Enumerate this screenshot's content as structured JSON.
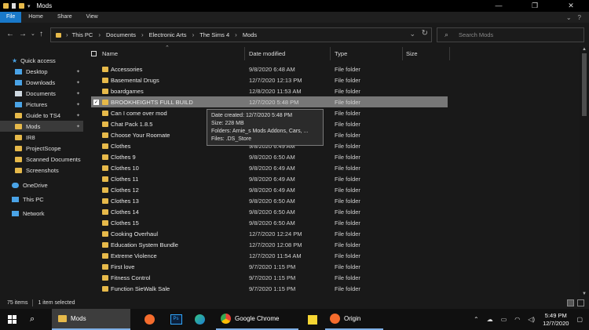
{
  "window": {
    "title": "Mods",
    "controls": [
      "—",
      "❐",
      "✕"
    ]
  },
  "ribbon": {
    "tabs": [
      "File",
      "Home",
      "Share",
      "View"
    ]
  },
  "address": {
    "crumbs": [
      "This PC",
      "Documents",
      "Electronic Arts",
      "The Sims 4",
      "Mods"
    ],
    "search_placeholder": "Search Mods"
  },
  "nav": {
    "items": [
      {
        "label": "Quick access",
        "icon": "star-icon",
        "color": "#4aa3e6",
        "pinned": false
      },
      {
        "label": "Desktop",
        "icon": "desktop-icon",
        "color": "#4aa3e6",
        "pinned": true
      },
      {
        "label": "Downloads",
        "icon": "download-icon",
        "color": "#4aa3e6",
        "pinned": true
      },
      {
        "label": "Documents",
        "icon": "documents-icon",
        "color": "#cfd8e0",
        "pinned": true
      },
      {
        "label": "Pictures",
        "icon": "pictures-icon",
        "color": "#4aa3e6",
        "pinned": true
      },
      {
        "label": "Guide to TS4",
        "icon": "folder-icon",
        "color": "#e6b94a",
        "pinned": true
      },
      {
        "label": "Mods",
        "icon": "folder-icon",
        "color": "#e6b94a",
        "pinned": true,
        "selected": true
      },
      {
        "label": "IR8",
        "icon": "folder-icon",
        "color": "#e6b94a",
        "pinned": false
      },
      {
        "label": "ProjectScope",
        "icon": "folder-icon",
        "color": "#e6b94a",
        "pinned": false
      },
      {
        "label": "Scanned Documents",
        "icon": "folder-icon",
        "color": "#e6b94a",
        "pinned": false
      },
      {
        "label": "Screenshots",
        "icon": "folder-icon",
        "color": "#e6b94a",
        "pinned": false
      },
      {
        "label": "OneDrive",
        "icon": "cloud-icon",
        "color": "#4aa3e6",
        "pinned": false
      },
      {
        "label": "This PC",
        "icon": "computer-icon",
        "color": "#4aa3e6",
        "pinned": false
      },
      {
        "label": "Network",
        "icon": "network-icon",
        "color": "#4aa3e6",
        "pinned": false
      }
    ]
  },
  "columns": {
    "name": "Name",
    "date": "Date modified",
    "type": "Type",
    "size": "Size"
  },
  "files": [
    {
      "name": "Accessories",
      "date": "9/8/2020 6:48 AM",
      "type": "File folder"
    },
    {
      "name": "Basemental Drugs",
      "date": "12/7/2020 12:13 PM",
      "type": "File folder"
    },
    {
      "name": "boardgames",
      "date": "12/8/2020 11:53 AM",
      "type": "File folder"
    },
    {
      "name": "BROOKHEIGHTS FULL BUILD",
      "date": "12/7/2020 5:48 PM",
      "type": "File folder",
      "selected": true
    },
    {
      "name": "Can I come over mod",
      "date": "",
      "type": "File folder"
    },
    {
      "name": "Chat Pack 1.8.5",
      "date": "",
      "type": "File folder"
    },
    {
      "name": "Choose Your Roomate",
      "date": "",
      "type": "File folder"
    },
    {
      "name": "Clothes",
      "date": "9/8/2020 6:49 AM",
      "type": "File folder"
    },
    {
      "name": "Clothes 9",
      "date": "9/8/2020 6:50 AM",
      "type": "File folder"
    },
    {
      "name": "Clothes 10",
      "date": "9/8/2020 6:49 AM",
      "type": "File folder"
    },
    {
      "name": "Clothes 11",
      "date": "9/8/2020 6:49 AM",
      "type": "File folder"
    },
    {
      "name": "Clothes 12",
      "date": "9/8/2020 6:49 AM",
      "type": "File folder"
    },
    {
      "name": "Clothes 13",
      "date": "9/8/2020 6:50 AM",
      "type": "File folder"
    },
    {
      "name": "Clothes 14",
      "date": "9/8/2020 6:50 AM",
      "type": "File folder"
    },
    {
      "name": "Clothes 15",
      "date": "9/8/2020 6:50 AM",
      "type": "File folder"
    },
    {
      "name": "Cooking Overhaul",
      "date": "12/7/2020 12:24 PM",
      "type": "File folder"
    },
    {
      "name": "Education System Bundle",
      "date": "12/7/2020 12:08 PM",
      "type": "File folder"
    },
    {
      "name": "Extreme Violence",
      "date": "12/7/2020 11:54 AM",
      "type": "File folder"
    },
    {
      "name": "First love",
      "date": "9/7/2020 1:15 PM",
      "type": "File folder"
    },
    {
      "name": "Fitness Control",
      "date": "9/7/2020 1:15 PM",
      "type": "File folder"
    },
    {
      "name": "Function SieWalk Sale",
      "date": "9/7/2020 1:15 PM",
      "type": "File folder"
    }
  ],
  "tooltip": {
    "created": "Date created: 12/7/2020 5:48 PM",
    "size": "Size: 228 MB",
    "folders": "Folders: Arnie_s Mods Addons, Cars, ...",
    "files": "Files: .DS_Store"
  },
  "status": {
    "count": "75 items",
    "selected": "1 item selected"
  },
  "taskbar": {
    "explorer_label": "Mods",
    "chrome_label": "Google Chrome",
    "origin_label": "Origin",
    "ps_label": "Ps",
    "time": "5:49 PM",
    "date": "12/7/2020"
  }
}
